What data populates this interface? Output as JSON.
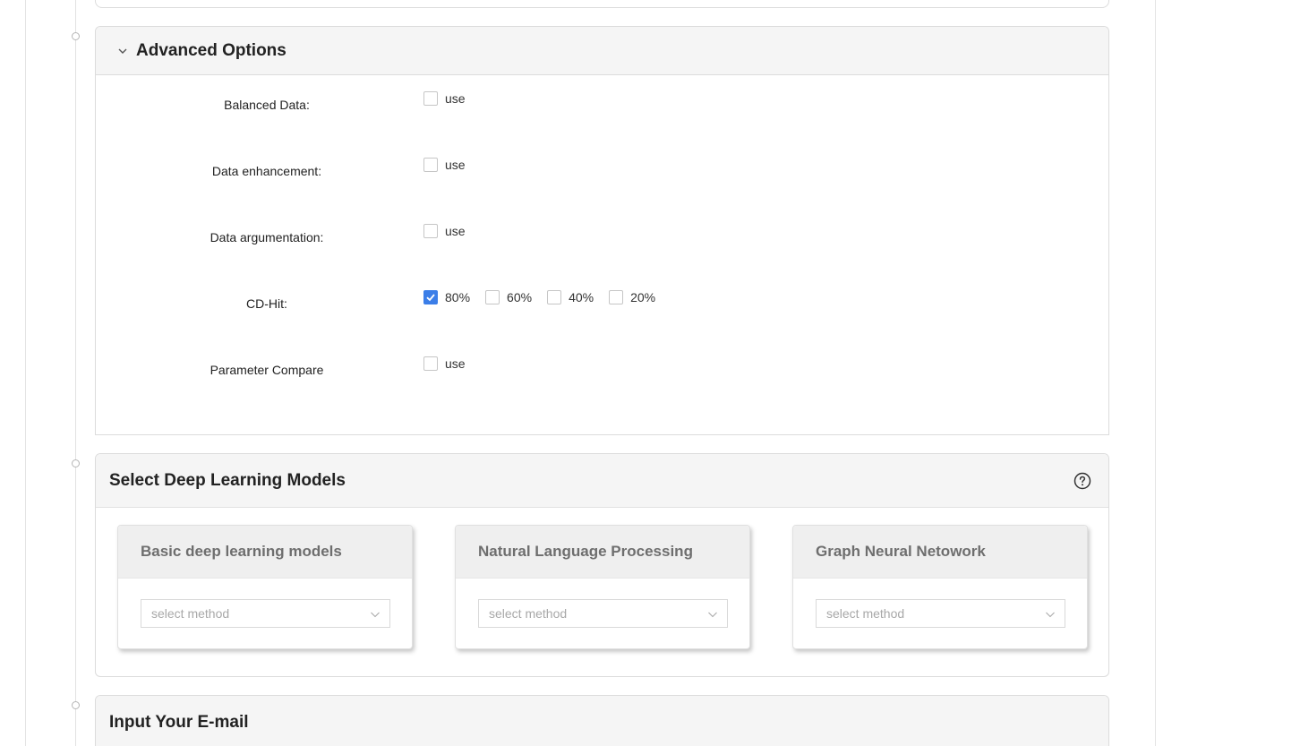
{
  "advanced": {
    "title": "Advanced Options",
    "rows": [
      {
        "label": "Balanced Data:",
        "options": [
          {
            "label": "use",
            "checked": false
          }
        ]
      },
      {
        "label": "Data enhancement:",
        "options": [
          {
            "label": "use",
            "checked": false
          }
        ]
      },
      {
        "label": "Data argumentation:",
        "options": [
          {
            "label": "use",
            "checked": false
          }
        ]
      },
      {
        "label": "CD-Hit:",
        "options": [
          {
            "label": "80%",
            "checked": true
          },
          {
            "label": "60%",
            "checked": false
          },
          {
            "label": "40%",
            "checked": false
          },
          {
            "label": "20%",
            "checked": false
          }
        ]
      },
      {
        "label": "Parameter Compare",
        "options": [
          {
            "label": "use",
            "checked": false
          }
        ]
      }
    ]
  },
  "models": {
    "title": "Select Deep Learning Models",
    "help_icon": "question-circle-icon",
    "boxes": [
      {
        "title": "Basic deep learning models",
        "placeholder": "select method"
      },
      {
        "title": "Natural Language Processing",
        "placeholder": "select method"
      },
      {
        "title": "Graph Neural Netowork",
        "placeholder": "select method"
      }
    ]
  },
  "email": {
    "title": "Input Your E-mail"
  },
  "colors": {
    "accent": "#3b7ee8",
    "header_bg": "#f5f5f5",
    "border": "#dcdcdc"
  }
}
